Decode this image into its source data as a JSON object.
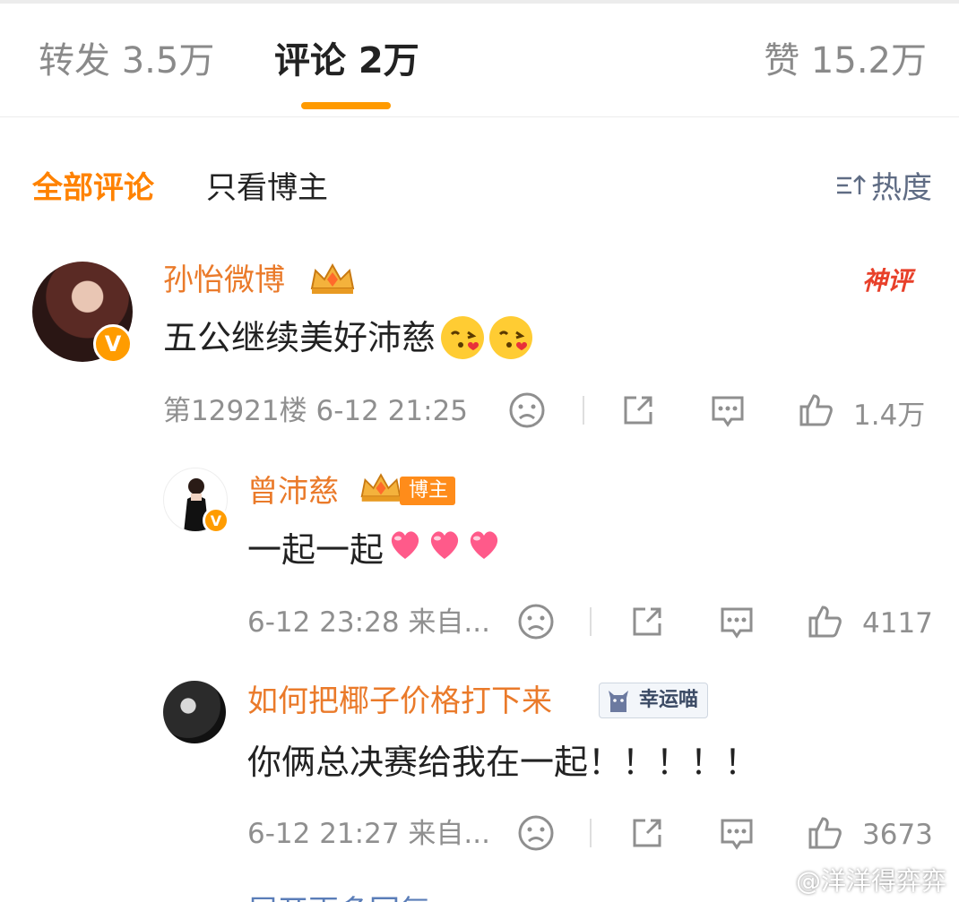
{
  "tabs": {
    "repost": "转发 3.5万",
    "comment": "评论 2万",
    "like": "赞 15.2万"
  },
  "filter": {
    "all": "全部评论",
    "blogger_only": "只看博主",
    "sort": "热度"
  },
  "comments": [
    {
      "username": "孙怡微博",
      "content": "五公继续美好沛慈",
      "badge": "神评",
      "meta": "第12921楼  6-12 21:25",
      "likes": "1.4万",
      "replies": [
        {
          "username": "曾沛慈",
          "tag": "博主",
          "content": "一起一起",
          "meta": "6-12 23:28  来自...",
          "likes": "4117"
        },
        {
          "username": "如何把椰子价格打下来",
          "tag": "幸运喵",
          "content": "你俩总决赛给我在一起！！！！！",
          "meta": "6-12 21:27  来自...",
          "likes": "3673"
        }
      ]
    }
  ],
  "more_replies": "展开更多回复",
  "watermark": "@洋洋得弈弈",
  "colors": {
    "accent": "#ff8200",
    "username": "#ea7a2a",
    "underline": "#ff9a00",
    "meta": "#8f8f8f"
  }
}
